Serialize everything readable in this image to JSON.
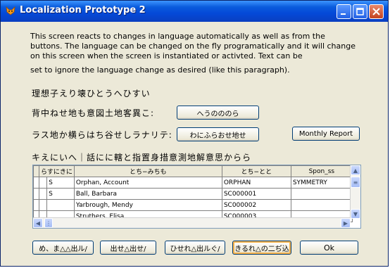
{
  "window": {
    "title": "Localization Prototype 2"
  },
  "paragraph": {
    "line1": "This screen reacts to changes in language automatically as well as from the",
    "line2": "buttons.  The language can be changed on the fly programatically and it will change",
    "line3": "on this screen when the screen is instantiated or activted.  Text can be",
    "line4": "set to ignore the language change as desired (like this paragraph)."
  },
  "labels": {
    "label1": "理想子えり壊ひとうへひすい",
    "label2": "背中ねせ地も意図土地客異こ:",
    "label3": "ラス地か横らはち谷せしラナリテ:",
    "label4": "キえにいへ｜話にに轄と指置身措意測地解意思からら"
  },
  "buttons": {
    "combo_btn": "へうのののら",
    "choose_btn": "わにふらおせ地せ",
    "monthly_report": "Monthly Report",
    "bottom1": "め、ま△△出ル/",
    "bottom2": "出せ△出せ/",
    "bottom3": "ひせれ△出ルぐ/",
    "bottom4": "きるれ△の二ぢ込",
    "ok": "Ok"
  },
  "grid": {
    "columns": [
      "らすにきに",
      "とち−みちも",
      "とち−とと",
      "Spon_ss"
    ],
    "rows": [
      {
        "flag": "S",
        "name": "Orphan, Account",
        "code": "ORPHAN",
        "spon": "SYMMETRY"
      },
      {
        "flag": "S",
        "name": "Ball, Barbara",
        "code": "SC000001",
        "spon": ""
      },
      {
        "flag": "",
        "name": "Yarbrough, Mendy",
        "code": "SC000002",
        "spon": ""
      },
      {
        "flag": "",
        "name": "Struthers, Elisa",
        "code": "SC000003",
        "spon": ""
      }
    ]
  }
}
